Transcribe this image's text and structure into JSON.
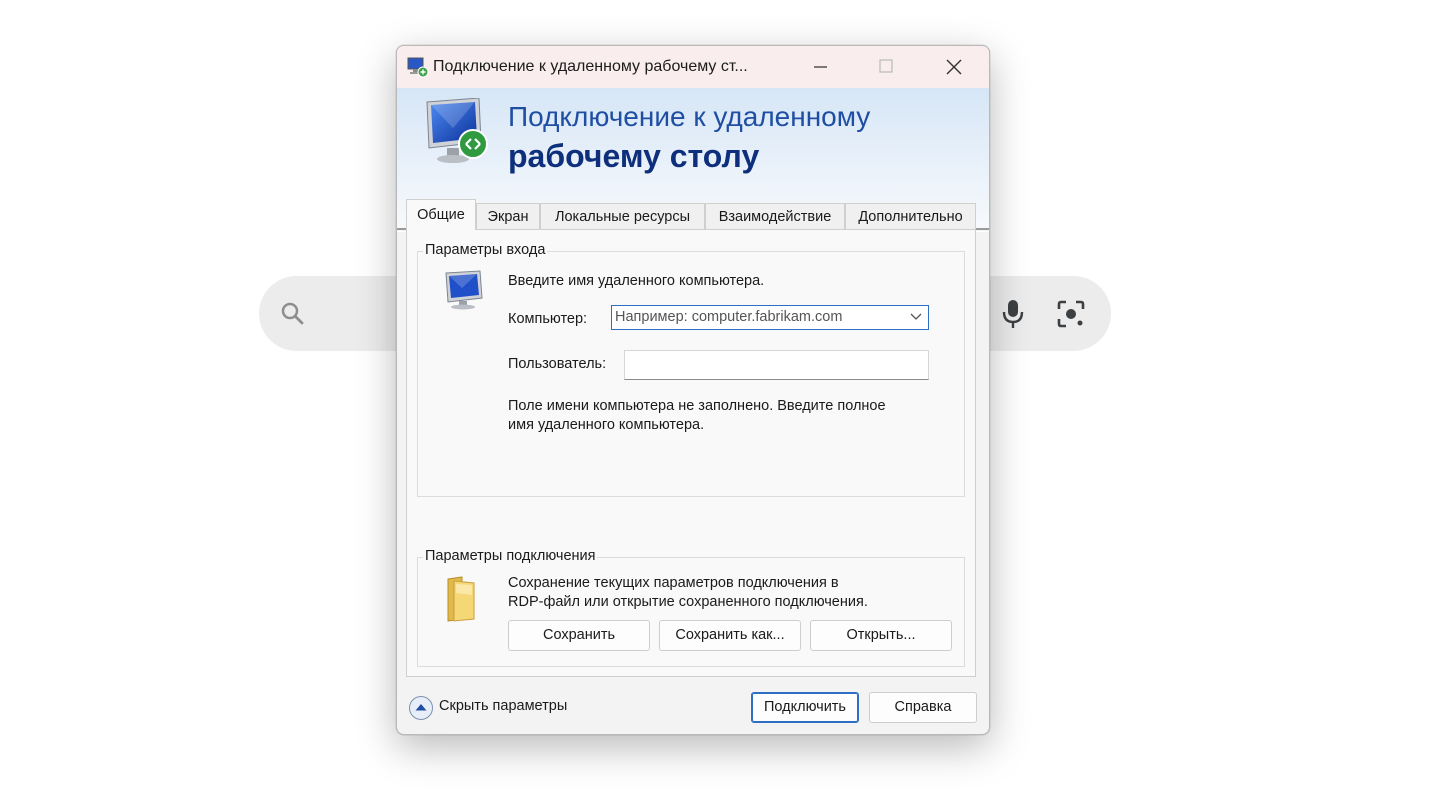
{
  "window": {
    "title": "Подключение к удаленному рабочему ст...",
    "icon": "remote-desktop-icon"
  },
  "banner": {
    "line1": "Подключение к удаленному",
    "line2": "рабочему столу"
  },
  "tabs": [
    {
      "label": "Общие",
      "active": true
    },
    {
      "label": "Экран",
      "active": false
    },
    {
      "label": "Локальные ресурсы",
      "active": false
    },
    {
      "label": "Взаимодействие",
      "active": false
    },
    {
      "label": "Дополнительно",
      "active": false
    }
  ],
  "login": {
    "group_title": "Параметры входа",
    "prompt": "Введите имя удаленного компьютера.",
    "computer_label": "Компьютер:",
    "computer_placeholder": "Например: computer.fabrikam.com",
    "user_label": "Пользователь:",
    "user_value": "",
    "hint_line1": "Поле имени компьютера не заполнено. Введите полное",
    "hint_line2": "имя удаленного компьютера."
  },
  "connection": {
    "group_title": "Параметры подключения",
    "desc_line1": "Сохранение текущих параметров подключения в",
    "desc_line2": "RDP-файл или открытие сохраненного подключения.",
    "save": "Сохранить",
    "save_as": "Сохранить как...",
    "open": "Открыть..."
  },
  "footer": {
    "hide_options": "Скрыть параметры",
    "connect": "Подключить",
    "help": "Справка"
  },
  "colors": {
    "banner_text": "#1f4ea3",
    "banner_bold": "#0e2f7c",
    "focus_border": "#2e6fc5"
  }
}
